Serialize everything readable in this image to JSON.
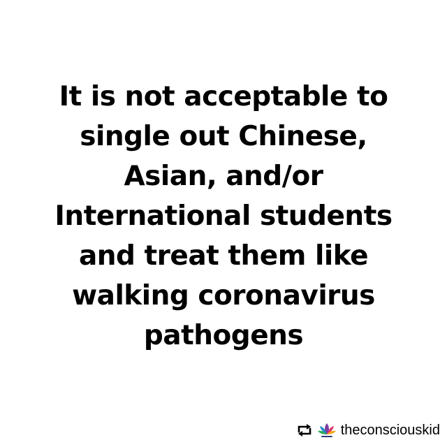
{
  "post": {
    "message_lines": [
      "It is not acceptable to",
      "single out Chinese,",
      "Asian, and/or",
      "International students",
      "and treat them like",
      "walking coronavirus",
      "pathogens"
    ]
  },
  "repost": {
    "icon": "repost-icon",
    "avatar": "lotus-logo-avatar",
    "username": "theconsciouskid"
  },
  "colors": {
    "background": "#ffffff",
    "text": "#000000"
  }
}
